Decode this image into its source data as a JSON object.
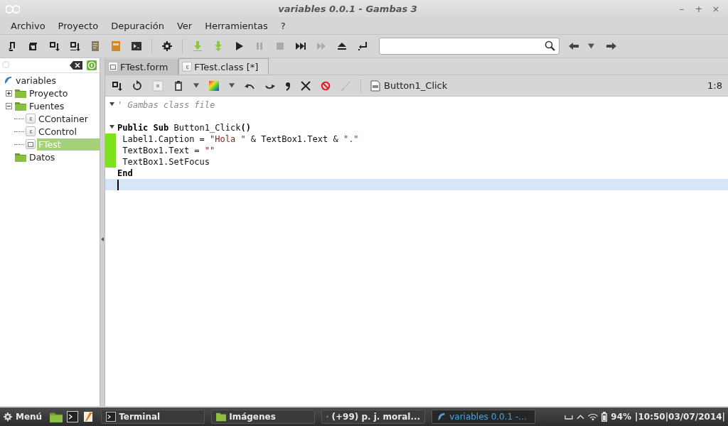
{
  "window": {
    "title": "variables 0.0.1 - Gambas 3",
    "controls": [
      "–",
      "+",
      "×"
    ]
  },
  "menu": [
    {
      "label": "Archivo"
    },
    {
      "label": "Proyecto"
    },
    {
      "label": "Depuración"
    },
    {
      "label": "Ver"
    },
    {
      "label": "Herramientas"
    },
    {
      "label": "?"
    }
  ],
  "toolbar": {
    "buttons": [
      {
        "kind": "new",
        "disabled": false
      },
      {
        "kind": "windows",
        "disabled": false
      },
      {
        "kind": "form-in",
        "disabled": false
      },
      {
        "kind": "form-out",
        "disabled": false
      },
      {
        "kind": "notes",
        "disabled": false
      },
      {
        "kind": "book",
        "disabled": false
      },
      {
        "kind": "terminal",
        "disabled": false
      },
      {
        "kind": "gear",
        "disabled": false
      },
      {
        "kind": "compile",
        "disabled": false
      },
      {
        "kind": "compile-all",
        "disabled": false
      },
      {
        "kind": "play",
        "disabled": false
      },
      {
        "kind": "pause",
        "disabled": true
      },
      {
        "kind": "stop",
        "disabled": true
      },
      {
        "kind": "step",
        "disabled": false
      },
      {
        "kind": "forward",
        "disabled": true
      },
      {
        "kind": "eject",
        "disabled": false
      },
      {
        "kind": "return",
        "disabled": false
      }
    ]
  },
  "project_tree": {
    "root": "variables",
    "items": [
      {
        "label": "Proyecto",
        "kind": "folder",
        "expanded": false,
        "selected": false
      },
      {
        "label": "Fuentes",
        "kind": "folder",
        "expanded": true,
        "selected": false,
        "children": [
          {
            "label": "CContainer",
            "kind": "class",
            "selected": false
          },
          {
            "label": "CControl",
            "kind": "class",
            "selected": false
          },
          {
            "label": "FTest",
            "kind": "form",
            "selected": true
          }
        ]
      },
      {
        "label": "Datos",
        "kind": "folder",
        "selected": false
      }
    ]
  },
  "tabs": [
    {
      "label": "FTest.form",
      "kind": "form",
      "selected": false
    },
    {
      "label": "FTest.class [*]",
      "kind": "class",
      "selected": true
    }
  ],
  "editor_toolbar": {
    "procedure": "Button1_Click",
    "position": "1:8"
  },
  "code": [
    {
      "foldable": true,
      "modified": false,
      "current": false,
      "tokens": [
        {
          "kind": "comment",
          "text": "' Gambas class file"
        }
      ]
    },
    {
      "foldable": false,
      "modified": false,
      "current": false
    },
    {
      "foldable": true,
      "modified": false,
      "current": false,
      "tokens": [
        {
          "kind": "keyword",
          "text": "Public Sub"
        },
        {
          "kind": "plain",
          "text": " Button1_Click"
        },
        {
          "kind": "keyword",
          "text": "()"
        }
      ]
    },
    {
      "foldable": false,
      "modified": true,
      "current": false,
      "tokens": [
        {
          "kind": "plain",
          "text": " Label1.Caption = "
        },
        {
          "kind": "string",
          "text": "\"Hola \""
        },
        {
          "kind": "plain",
          "text": " & TextBox1.Text & "
        },
        {
          "kind": "string",
          "text": "\".\""
        }
      ]
    },
    {
      "foldable": false,
      "modified": true,
      "current": false,
      "tokens": [
        {
          "kind": "plain",
          "text": " TextBox1.Text = "
        },
        {
          "kind": "string",
          "text": "\"\""
        }
      ]
    },
    {
      "foldable": false,
      "modified": true,
      "current": false,
      "tokens": [
        {
          "kind": "plain",
          "text": " TextBox1.SetFocus"
        }
      ]
    },
    {
      "foldable": false,
      "modified": false,
      "current": false,
      "tokens": [
        {
          "kind": "keyword",
          "text": "End"
        }
      ]
    },
    {
      "foldable": false,
      "modified": false,
      "current": true
    }
  ],
  "taskbar": {
    "start": "Menú",
    "tasks": [
      {
        "label": "Terminal",
        "kind": "terminal",
        "selected": false
      },
      {
        "label": "Imágenes",
        "kind": "folder",
        "selected": false
      },
      {
        "label": "(+99) p. j. moral...",
        "kind": "browser",
        "selected": false
      },
      {
        "label": "variables 0.0.1 -...",
        "kind": "gambas",
        "selected": true
      }
    ],
    "battery": "94%",
    "clock": "|10:50|03/07/2014|"
  }
}
